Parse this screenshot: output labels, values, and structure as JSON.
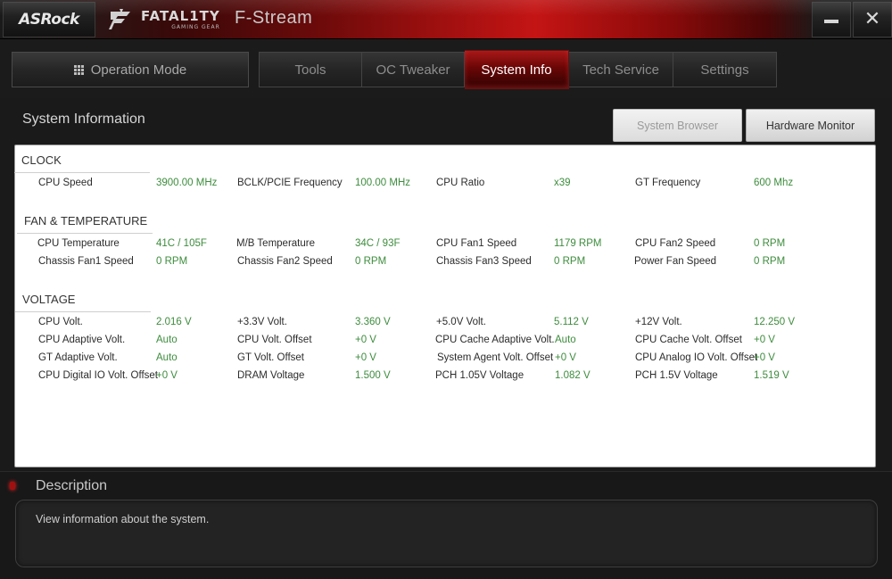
{
  "titlebar": {
    "brand": "ASRock",
    "fatality_main": "FATAL1TY",
    "fatality_sub": "GAMING GEAR",
    "app_name": "F-Stream"
  },
  "nav": {
    "operation_mode": "Operation Mode",
    "tabs": [
      {
        "label": "Tools",
        "active": false
      },
      {
        "label": "OC Tweaker",
        "active": false
      },
      {
        "label": "System Info",
        "active": true
      },
      {
        "label": "Tech Service",
        "active": false
      },
      {
        "label": "Settings",
        "active": false
      }
    ]
  },
  "page": {
    "title": "System Information",
    "system_browser_label": "System Browser",
    "hardware_monitor_label": "Hardware Monitor"
  },
  "clock": {
    "title": "CLOCK",
    "rows": [
      [
        {
          "label": "CPU Speed",
          "value": "3900.00 MHz"
        },
        {
          "label": "BCLK/PCIE Frequency",
          "value": "100.00 MHz"
        },
        {
          "label": "CPU Ratio",
          "value": "x39"
        },
        {
          "label": "GT Frequency",
          "value": "600 Mhz"
        }
      ]
    ]
  },
  "fan": {
    "title": "FAN & TEMPERATURE",
    "rows": [
      [
        {
          "label": "CPU Temperature",
          "value": "41C / 105F"
        },
        {
          "label": "M/B Temperature",
          "value": "34C / 93F"
        },
        {
          "label": "CPU Fan1 Speed",
          "value": "1179 RPM"
        },
        {
          "label": "CPU Fan2 Speed",
          "value": "0 RPM"
        }
      ],
      [
        {
          "label": "Chassis Fan1 Speed",
          "value": "0 RPM"
        },
        {
          "label": "Chassis Fan2 Speed",
          "value": "0 RPM"
        },
        {
          "label": "Chassis Fan3 Speed",
          "value": "0 RPM"
        },
        {
          "label": "Power Fan Speed",
          "value": "0 RPM"
        }
      ]
    ]
  },
  "voltage": {
    "title": "VOLTAGE",
    "rows": [
      [
        {
          "label": "CPU Volt.",
          "value": "2.016 V"
        },
        {
          "label": "+3.3V Volt.",
          "value": "3.360 V"
        },
        {
          "label": "+5.0V Volt.",
          "value": "5.112 V"
        },
        {
          "label": "+12V Volt.",
          "value": "12.250 V"
        }
      ],
      [
        {
          "label": "CPU Adaptive Volt.",
          "value": "Auto"
        },
        {
          "label": "CPU Volt. Offset",
          "value": "+0 V"
        },
        {
          "label": "CPU Cache Adaptive Volt.",
          "value": "Auto"
        },
        {
          "label": "CPU Cache Volt. Offset",
          "value": "+0 V"
        }
      ],
      [
        {
          "label": "GT Adaptive Volt.",
          "value": "Auto"
        },
        {
          "label": "GT Volt. Offset",
          "value": "+0 V"
        },
        {
          "label": "System Agent Volt. Offset",
          "value": "+0 V"
        },
        {
          "label": "CPU Analog IO Volt. Offset",
          "value": "+0 V"
        }
      ],
      [
        {
          "label": "CPU Digital IO Volt. Offset",
          "value": "+0 V"
        },
        {
          "label": "DRAM Voltage",
          "value": "1.500 V"
        },
        {
          "label": "PCH 1.05V Voltage",
          "value": "1.082 V"
        },
        {
          "label": "PCH 1.5V Voltage",
          "value": "1.519 V"
        }
      ]
    ]
  },
  "description": {
    "title": "Description",
    "text": "View information about the system."
  },
  "colors": {
    "accent_red": "#c41414",
    "value_green": "#3d8c3d"
  }
}
